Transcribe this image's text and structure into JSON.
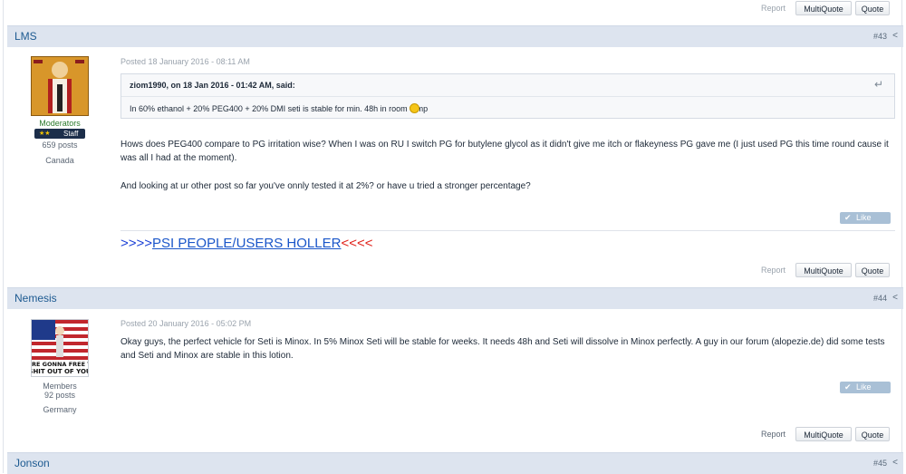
{
  "top_actions": {
    "report": "Report",
    "multiquote": "MultiQuote",
    "quote": "Quote"
  },
  "posts": [
    {
      "author": "LMS",
      "number": "#43",
      "group": "Moderators",
      "badge_stars": "★★",
      "badge": "Staff",
      "post_count": "659 posts",
      "location": "Canada",
      "posted": "Posted 18 January 2016 - 08:11 AM",
      "quote_header": "ziom1990, on 18 Jan 2016 - 01:42 AM, said:",
      "quote_body": "In 60% ethanol + 20% PEG400 + 20% DMI seti is stable for min. 48h in room temp",
      "paragraphs": [
        "Hows does PEG400 compare to PG irritation wise?   When I was on RU I switch PG for butylene glycol as it didn't give me itch or flakeyness PG gave me (I just used PG this time round cause it was all I had at the moment).",
        "And looking at ur other post so far you've onnly tested it at 2%? or have u tried a stronger percentage?"
      ],
      "like": "Like This",
      "signature": {
        "left": ">>>>",
        "link": "PSI PEOPLE/USERS HOLLER",
        "right": "<<<<"
      },
      "report": "Report",
      "multiquote": "MultiQuote",
      "quote": "Quote"
    },
    {
      "author": "Nemesis",
      "number": "#44",
      "group": "Members",
      "post_count": "92 posts",
      "location": "Germany",
      "posted": "Posted 20 January 2016 - 05:02 PM",
      "avatar_text": "WE'RE GONNA FREE THE SHIT OUT OF YOU",
      "paragraphs": [
        "Okay guys, the perfect vehicle for Seti is Minox. In 5% Minox Seti will be stable for weeks. It needs 48h and Seti will dissolve in Minox perfectly. A guy in our forum (alopezie.de) did some tests and Seti and Minox are stable in this lotion."
      ],
      "like": "Like This",
      "report": "Report",
      "multiquote": "MultiQuote",
      "quote": "Quote"
    },
    {
      "author": "Jonson",
      "number": "#45"
    }
  ],
  "share_icon": "<",
  "colors": {
    "header_bg": "#dde4ef",
    "author_link": "#1d5a91",
    "signature_blue": "#1a3fd6",
    "signature_red": "#e0221b",
    "like_bg": "#a9c0d6"
  }
}
